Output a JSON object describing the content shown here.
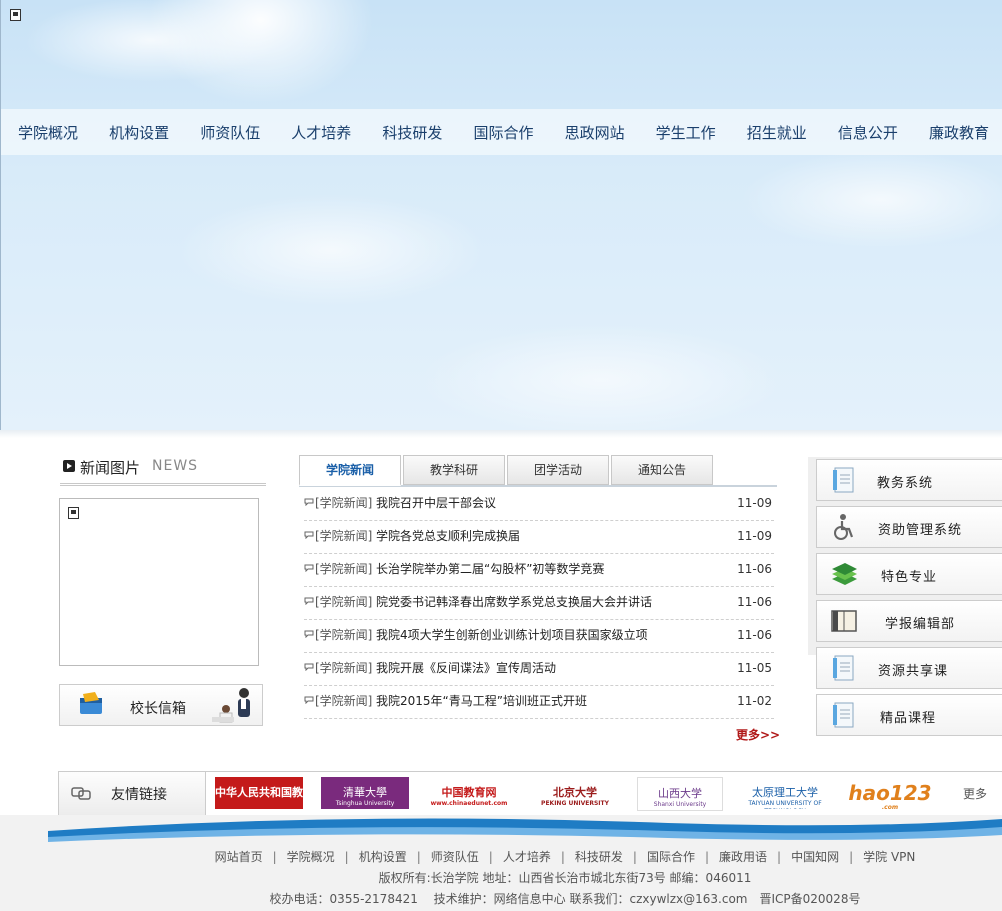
{
  "nav": [
    "学院概况",
    "机构设置",
    "师资队伍",
    "人才培养",
    "科技研发",
    "国际合作",
    "思政网站",
    "学生工作",
    "招生就业",
    "信息公开",
    "廉政教育"
  ],
  "news_pic": {
    "title": "新闻图片",
    "title_en": "NEWS"
  },
  "principal_mail": "校长信箱",
  "tabs": [
    "学院新闻",
    "教学科研",
    "团学活动",
    "通知公告"
  ],
  "news": [
    {
      "cat": "[学院新闻]",
      "title": "我院召开中层干部会议",
      "date": "11-09"
    },
    {
      "cat": "[学院新闻]",
      "title": "学院各党总支顺利完成换届",
      "date": "11-09"
    },
    {
      "cat": "[学院新闻]",
      "title": "长治学院举办第二届“勾股杯”初等数学竞赛",
      "date": "11-06"
    },
    {
      "cat": "[学院新闻]",
      "title": "院党委书记韩泽春出席数学系党总支换届大会并讲话",
      "date": "11-06"
    },
    {
      "cat": "[学院新闻]",
      "title": "我院4项大学生创新创业训练计划项目获国家级立项",
      "date": "11-06"
    },
    {
      "cat": "[学院新闻]",
      "title": "我院开展《反间谍法》宣传周活动",
      "date": "11-05"
    },
    {
      "cat": "[学院新闻]",
      "title": "我院2015年“青马工程”培训班正式开班",
      "date": "11-02"
    }
  ],
  "more": "更多>>",
  "side_links": [
    "教务系统",
    "资助管理系统",
    "特色专业",
    "学报编辑部",
    "资源共享课",
    "精品课程"
  ],
  "friends": {
    "title": "友情链接",
    "logos": [
      "中华人民共和国教育部",
      "清華大學",
      "中国教育网",
      "北京大学",
      "山西大学",
      "太原理工大学",
      "hao123"
    ],
    "logo_sub": [
      "Ministry of Education of the People's Republic of China",
      "Tsinghua University",
      "www.chinaedunet.com",
      "PEKING UNIVERSITY",
      "Shanxi University",
      "TAIYUAN UNIVERSITY OF TECHNOLOGY",
      ".com"
    ],
    "more": "更多"
  },
  "footer": {
    "links": [
      "网站首页",
      "学院概况",
      "机构设置",
      "师资队伍",
      "人才培养",
      "科技研发",
      "国际合作",
      "廉政用语",
      "中国知网",
      "学院 VPN"
    ],
    "copyright": "版权所有:长治学院 地址：山西省长治市城北东街73号 邮编：046011",
    "contact": "校办电话：0355-2178421　 技术维护：网络信息中心 联系我们：czxywlzx@163.com　晋ICP备020028号"
  },
  "colors": {
    "nav_text": "#1a3f6c",
    "tab_active": "#1a5fa8",
    "more": "#b01919"
  }
}
